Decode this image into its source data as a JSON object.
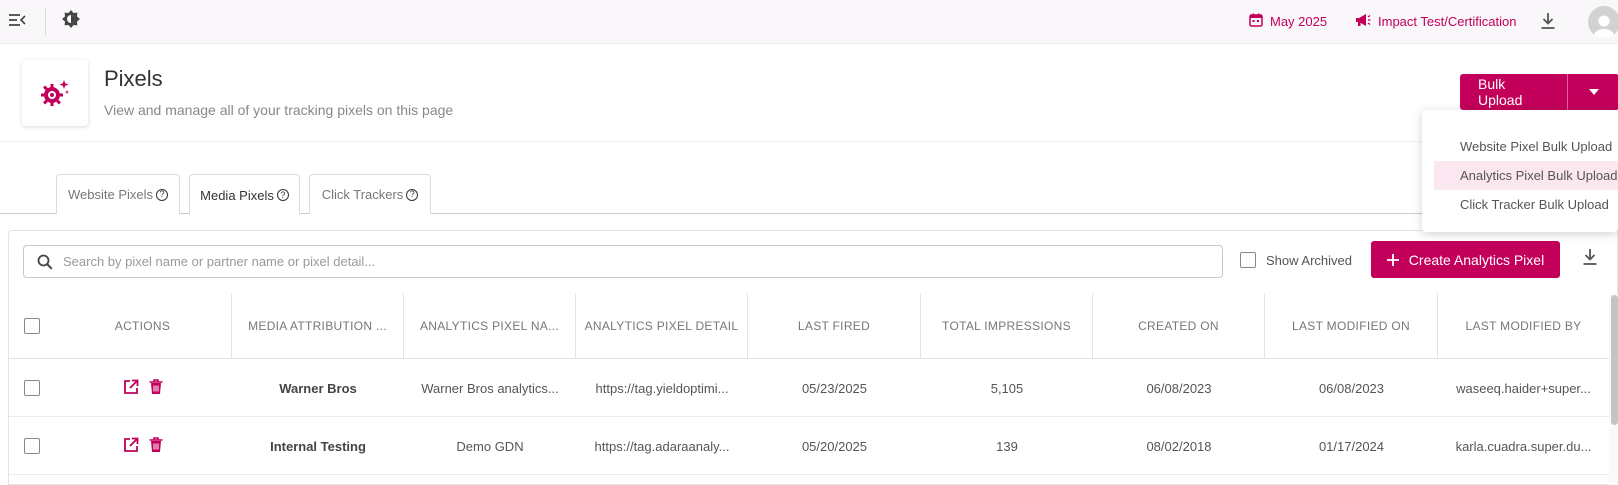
{
  "topbar": {
    "date_label": "May 2025",
    "campaign_label": "Impact Test/Certification"
  },
  "header": {
    "title": "Pixels",
    "subtitle": "View and manage all of your tracking pixels on this page",
    "bulk_upload_label": "Bulk Upload"
  },
  "bulk_menu": {
    "items": [
      {
        "label": "Website Pixel Bulk Upload"
      },
      {
        "label": "Analytics Pixel Bulk Upload"
      },
      {
        "label": "Click Tracker Bulk Upload"
      }
    ],
    "highlighted_index": 1
  },
  "tabs": [
    {
      "label": "Website Pixels"
    },
    {
      "label": "Media Pixels"
    },
    {
      "label": "Click Trackers"
    }
  ],
  "active_tab_index": 1,
  "toolbar": {
    "search_placeholder": "Search by pixel name or partner name or pixel detail...",
    "show_archived_label": "Show Archived",
    "create_label": "Create Analytics Pixel"
  },
  "table": {
    "columns": [
      "ACTIONS",
      "MEDIA ATTRIBUTION ...",
      "ANALYTICS PIXEL NA...",
      "ANALYTICS PIXEL DETAIL",
      "LAST FIRED",
      "TOTAL IMPRESSIONS",
      "CREATED ON",
      "LAST MODIFIED ON",
      "LAST MODIFIED BY"
    ],
    "rows": [
      {
        "media_attribution": "Warner Bros",
        "pixel_name": "Warner Bros analytics...",
        "pixel_detail": "https://tag.yieldoptimi...",
        "last_fired": "05/23/2025",
        "total_impressions": "5,105",
        "created_on": "06/08/2023",
        "last_modified_on": "06/08/2023",
        "last_modified_by": "waseeq.haider+super..."
      },
      {
        "media_attribution": "Internal Testing",
        "pixel_name": "Demo GDN",
        "pixel_detail": "https://tag.adaraanaly...",
        "last_fired": "05/20/2025",
        "total_impressions": "139",
        "created_on": "08/02/2018",
        "last_modified_on": "01/17/2024",
        "last_modified_by": "karla.cuadra.super.du..."
      }
    ]
  },
  "colors": {
    "accent": "#c2005b",
    "highlight": "#fbe7ef"
  }
}
